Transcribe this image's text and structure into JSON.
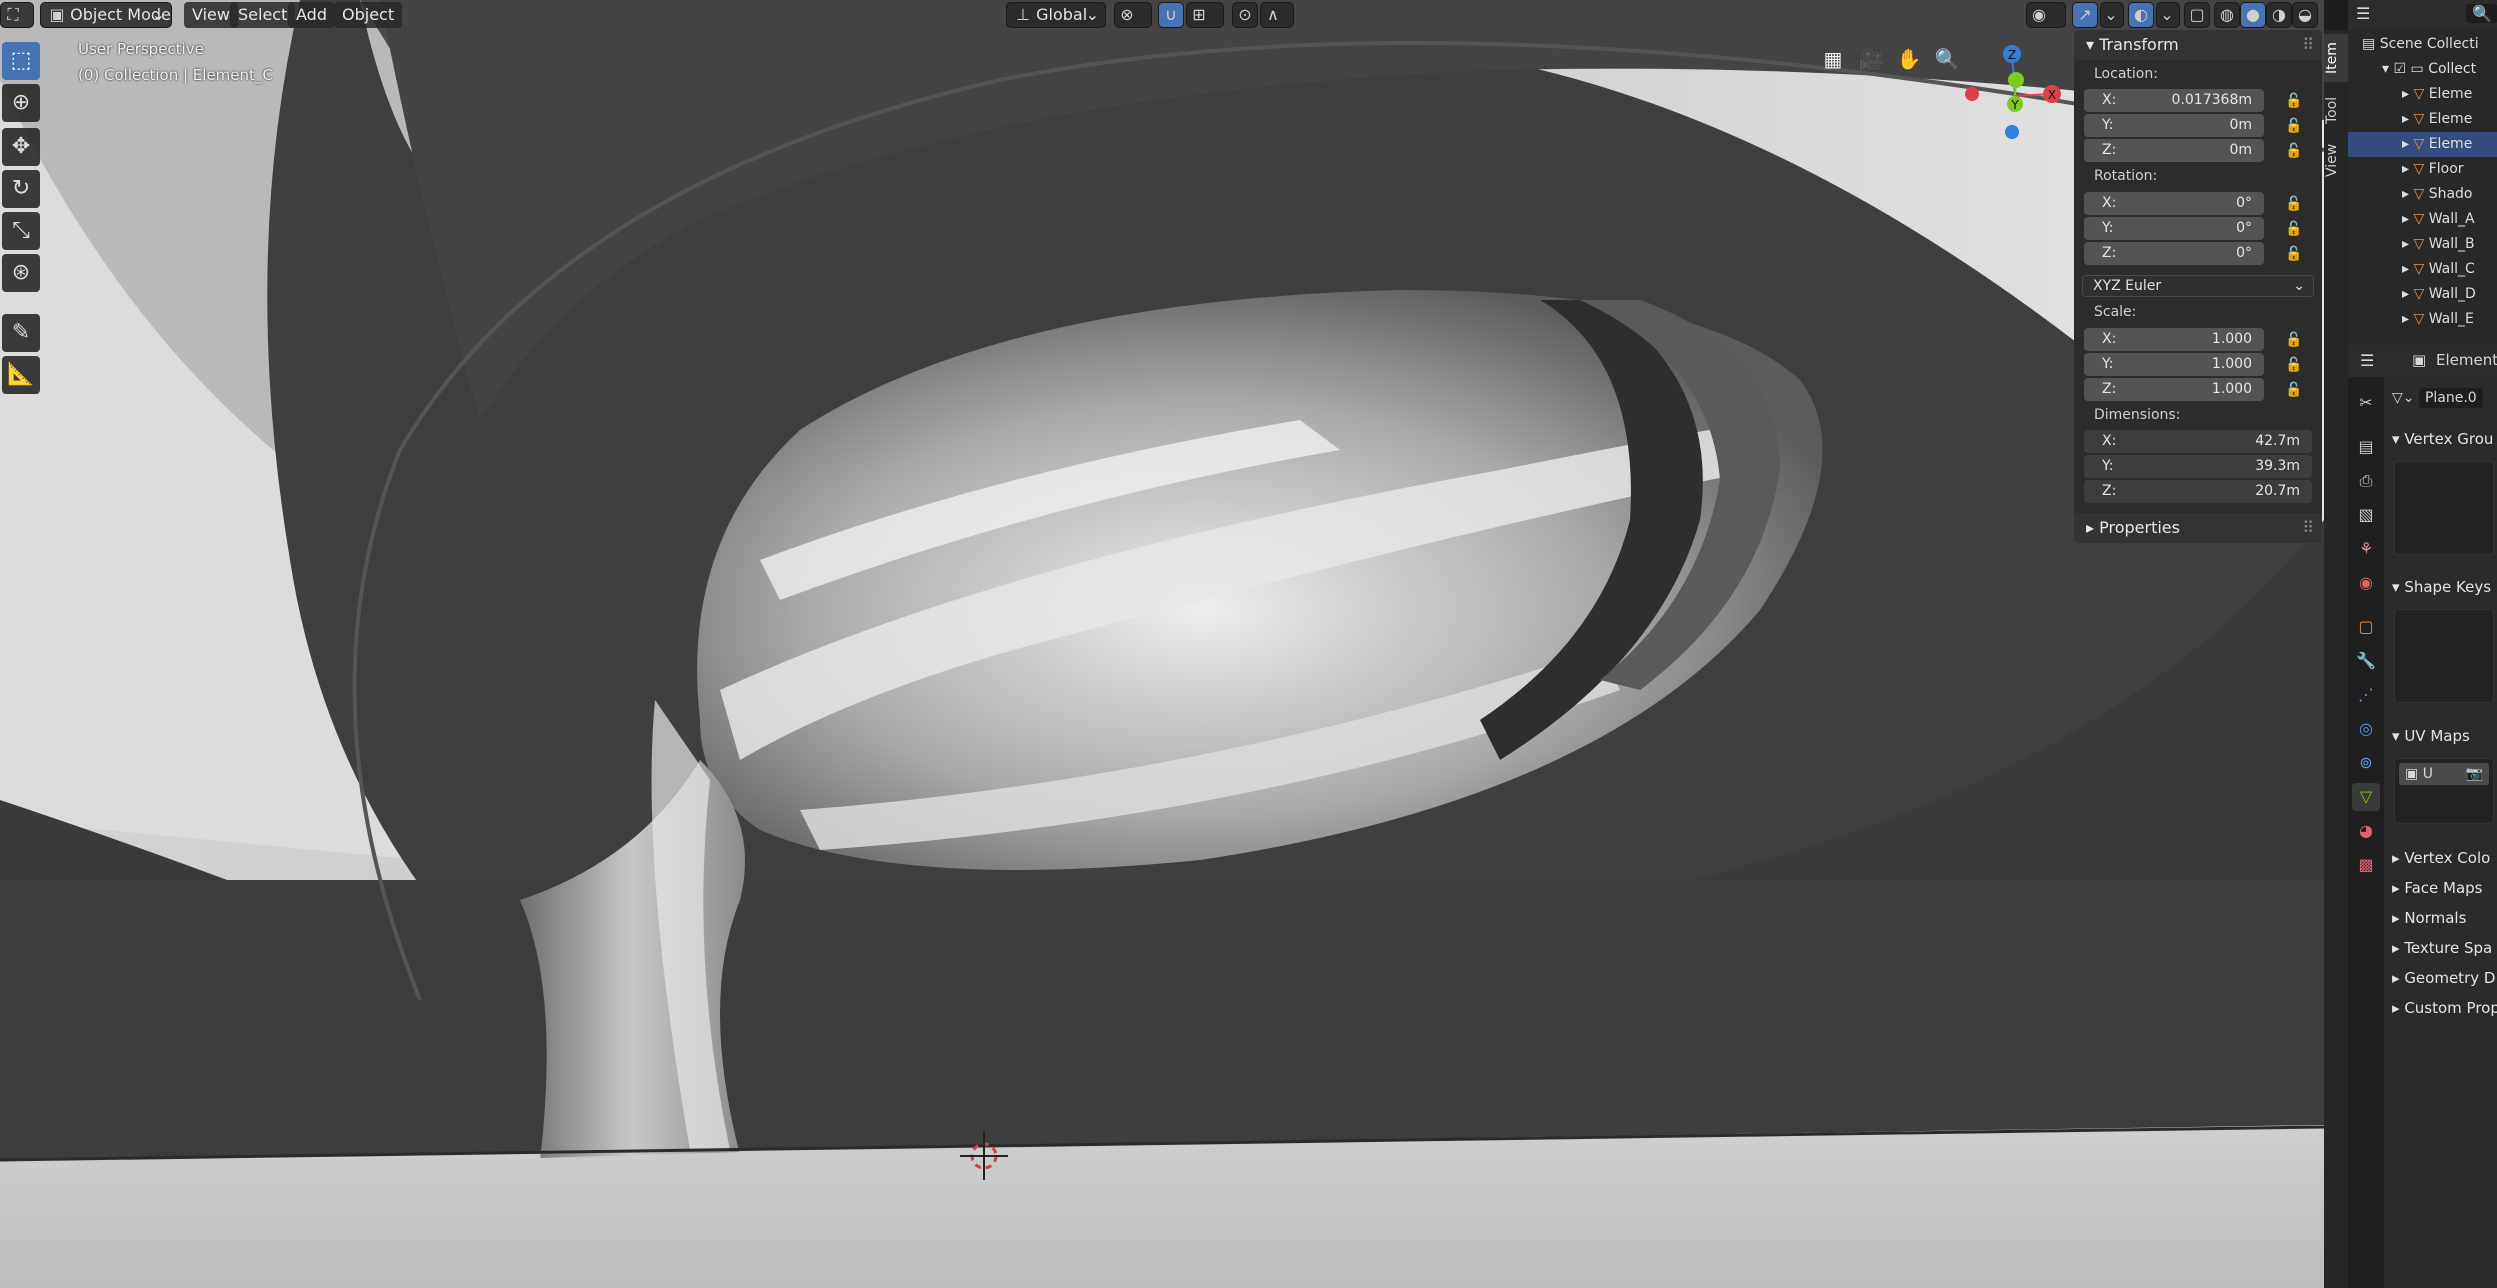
{
  "header": {
    "mode_label": "Object Mode",
    "menus": [
      "View",
      "Select",
      "Add",
      "Object"
    ],
    "orientation_label": "Global"
  },
  "viewport": {
    "perspective_label": "User Perspective",
    "collection_label": "(0) Collection | Element_C"
  },
  "tools": [
    {
      "name": "select-box-tool",
      "icon": "cursor-select-icon",
      "active": true
    },
    {
      "name": "cursor-tool",
      "icon": "3d-cursor-icon"
    },
    {
      "name": "move-tool",
      "icon": "move-icon"
    },
    {
      "name": "rotate-tool",
      "icon": "rotate-icon"
    },
    {
      "name": "scale-tool",
      "icon": "scale-icon"
    },
    {
      "name": "transform-tool",
      "icon": "transform-icon"
    },
    {
      "name": "annotate-tool",
      "icon": "annotate-icon"
    },
    {
      "name": "measure-tool",
      "icon": "measure-icon"
    }
  ],
  "gizmo": {
    "z": "Z",
    "y": "Y",
    "x": "X"
  },
  "npanel": {
    "transform_title": "Transform",
    "location_label": "Location:",
    "location": [
      {
        "axis": "X:",
        "value": "0.017368m"
      },
      {
        "axis": "Y:",
        "value": "0m"
      },
      {
        "axis": "Z:",
        "value": "0m"
      }
    ],
    "rotation_label": "Rotation:",
    "rotation": [
      {
        "axis": "X:",
        "value": "0°"
      },
      {
        "axis": "Y:",
        "value": "0°"
      },
      {
        "axis": "Z:",
        "value": "0°"
      }
    ],
    "rotation_mode": "XYZ Euler",
    "scale_label": "Scale:",
    "scale": [
      {
        "axis": "X:",
        "value": "1.000"
      },
      {
        "axis": "Y:",
        "value": "1.000"
      },
      {
        "axis": "Z:",
        "value": "1.000"
      }
    ],
    "dimensions_label": "Dimensions:",
    "dimensions": [
      {
        "axis": "X:",
        "value": "42.7m"
      },
      {
        "axis": "Y:",
        "value": "39.3m"
      },
      {
        "axis": "Z:",
        "value": "20.7m"
      }
    ],
    "properties_title": "Properties"
  },
  "side_tabs": [
    "Item",
    "Tool",
    "View"
  ],
  "outliner": {
    "rows": [
      {
        "label": "Scene Collecti",
        "kind": "scene"
      },
      {
        "label": "Collect",
        "kind": "collection"
      },
      {
        "label": "Eleme",
        "kind": "mesh"
      },
      {
        "label": "Eleme",
        "kind": "mesh"
      },
      {
        "label": "Eleme",
        "kind": "mesh",
        "selected": true
      },
      {
        "label": "Floor",
        "kind": "mesh"
      },
      {
        "label": "Shado",
        "kind": "mesh"
      },
      {
        "label": "Wall_A",
        "kind": "mesh"
      },
      {
        "label": "Wall_B",
        "kind": "mesh"
      },
      {
        "label": "Wall_C",
        "kind": "mesh"
      },
      {
        "label": "Wall_D",
        "kind": "mesh"
      },
      {
        "label": "Wall_E",
        "kind": "mesh"
      }
    ]
  },
  "properties": {
    "object_name": "Element",
    "mesh_name": "Plane.0",
    "vertex_groups": "Vertex Grou",
    "shape_keys": "Shape Keys",
    "uv_maps": "UV Maps",
    "uv_item": "U",
    "collapsed": [
      "Vertex Colo",
      "Face Maps",
      "Normals",
      "Texture Spa",
      "Geometry D",
      "Custom Prop"
    ]
  },
  "colors": {
    "accent": "#4772b3",
    "axis_x": "#e0404a",
    "axis_y": "#7ecb1f",
    "axis_z": "#2f7fdb",
    "mesh_icon": "#e8904a"
  }
}
